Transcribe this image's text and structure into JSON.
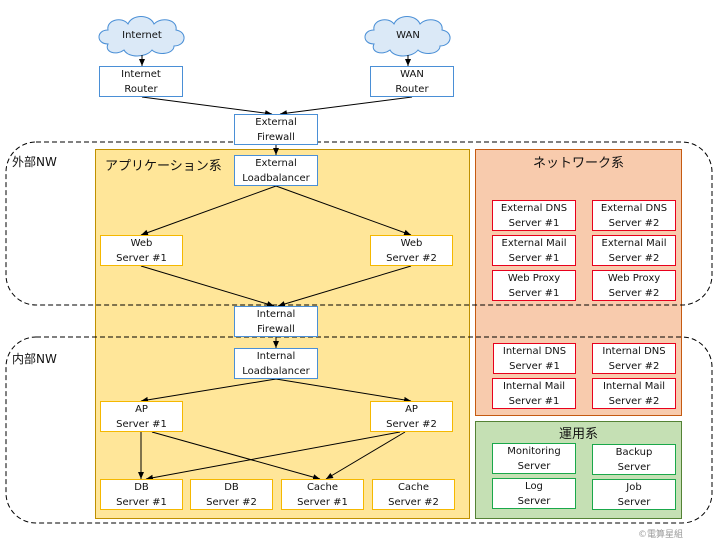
{
  "colors": {
    "application_fill": "#ffe699",
    "application_border": "#bf9000",
    "network_fill": "#f8cbad",
    "network_border": "#c55a11",
    "ops_fill": "#c5e0b4",
    "ops_border": "#548235",
    "infra_box_border": "#4a8fd6",
    "app_box_border": "#f5b800",
    "net_box_border": "#e8001c",
    "ops_box_border": "#1aa84a"
  },
  "zones": {
    "external": "外部NW",
    "internal": "内部NW"
  },
  "groups": {
    "application": "アプリケーション系",
    "network": "ネットワーク系",
    "operations": "運用系"
  },
  "clouds": {
    "internet": "Internet",
    "wan": "WAN"
  },
  "nodes": {
    "internet_router": "Internet\nRouter",
    "wan_router": "WAN\nRouter",
    "external_firewall": "External\nFirewall",
    "external_lb": "External\nLoadbalancer",
    "web1": "Web\nServer #1",
    "web2": "Web\nServer #2",
    "internal_firewall": "Internal\nFirewall",
    "internal_lb": "Internal\nLoadbalancer",
    "ap1": "AP\nServer #1",
    "ap2": "AP\nServer #2",
    "db1": "DB\nServer #1",
    "db2": "DB\nServer #2",
    "cache1": "Cache\nServer #1",
    "cache2": "Cache\nServer #2",
    "ext_dns1": "External DNS\nServer #1",
    "ext_dns2": "External DNS\nServer #2",
    "ext_mail1": "External Mail\nServer #1",
    "ext_mail2": "External Mail\nServer #2",
    "proxy1": "Web Proxy\nServer #1",
    "proxy2": "Web Proxy\nServer #2",
    "int_dns1": "Internal DNS\nServer #1",
    "int_dns2": "Internal DNS\nServer #2",
    "int_mail1": "Internal Mail\nServer #1",
    "int_mail2": "Internal Mail\nServer #2",
    "monitoring": "Monitoring\nServer",
    "backup": "Backup\nServer",
    "log": "Log\nServer",
    "job": "Job\nServer"
  },
  "copyright": "©電算星組"
}
